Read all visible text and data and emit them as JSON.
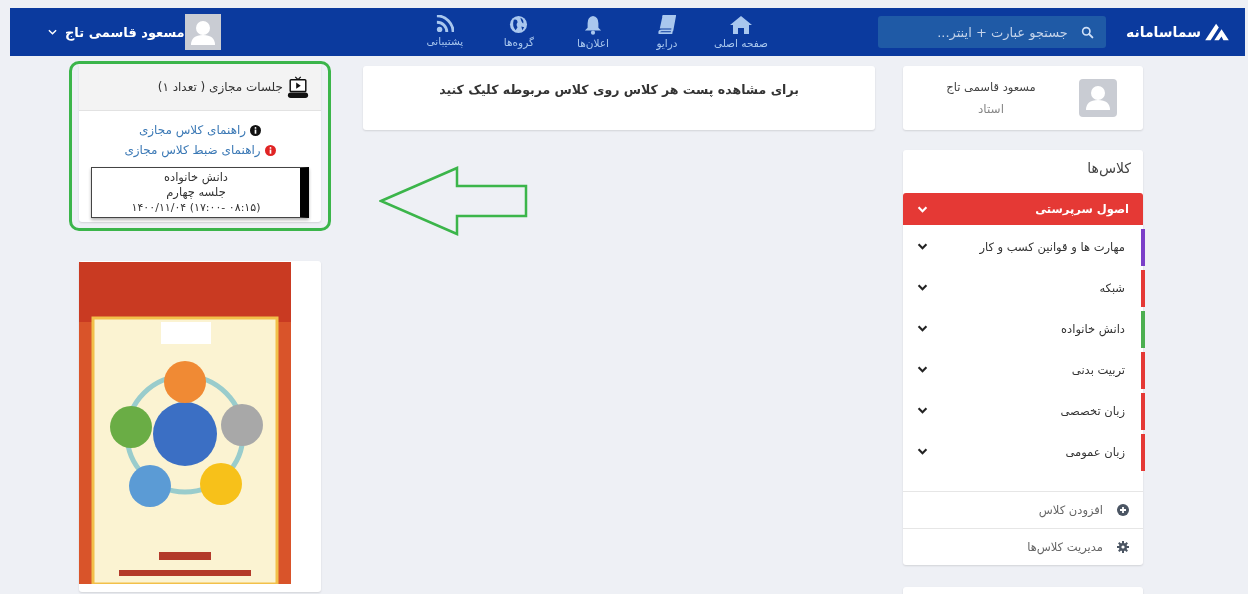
{
  "header": {
    "logo": "سماسامانه",
    "search": {
      "placeholder": "جستجو عبارت + اینتر..."
    },
    "nav": [
      {
        "label": "صفحه اصلی",
        "kind": "home"
      },
      {
        "label": "درایو",
        "kind": "book"
      },
      {
        "label": "اعلان‌ها",
        "kind": "bell"
      },
      {
        "label": "گروه‌ها",
        "kind": "globe"
      },
      {
        "label": "پشتیبانی",
        "kind": "rss"
      }
    ],
    "user": {
      "name": "مسعود قاسمی تاج"
    }
  },
  "profile": {
    "name": "مسعود قاسمی تاج",
    "role": "استاد"
  },
  "classes": {
    "title": "کلاس‌ها",
    "items": [
      {
        "name": "اصول سرپرستی",
        "color": "#e53935",
        "selected": true
      },
      {
        "name": "مهارت ها و قوانین کسب و کار",
        "color": "#7b3fc8",
        "selected": false
      },
      {
        "name": "شبکه",
        "color": "#e53935",
        "selected": false
      },
      {
        "name": "دانش خانواده",
        "color": "#4caf50",
        "selected": false
      },
      {
        "name": "تربیت بدنی",
        "color": "#e53935",
        "selected": false
      },
      {
        "name": "زبان تخصصی",
        "color": "#e53935",
        "selected": false
      },
      {
        "name": "زبان عمومی",
        "color": "#e53935",
        "selected": false
      }
    ],
    "actions": [
      {
        "label": "افزودن کلاس",
        "kind": "add"
      },
      {
        "label": "مدیریت کلاس‌ها",
        "kind": "manage"
      }
    ]
  },
  "notice": "برای مشاهده پست هر کلاس روی کلاس مربوطه کلیک کنید",
  "sessions": {
    "title": "جلسات مجازی ( تعداد ۱)",
    "links": [
      {
        "label": "راهنمای کلاس مجازی",
        "kind": "info"
      },
      {
        "label": "راهنمای ضبط کلاس مجازی",
        "kind": "alert"
      }
    ],
    "session": {
      "course": "دانش خانواده",
      "title": "جلسه چهارم",
      "time": "۱۴۰۰/۱۱/۰۴ (۱۷:۰۰- ۰۸:۱۵)"
    }
  }
}
